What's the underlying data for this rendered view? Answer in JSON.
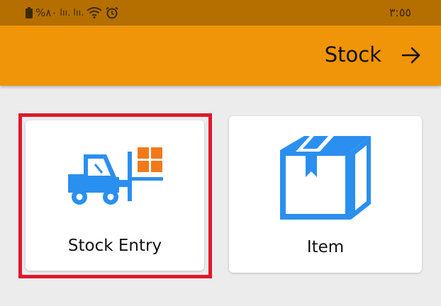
{
  "status_bar": {
    "battery": "%٨٠",
    "signal1": "lıı.",
    "signal2": "lıı.",
    "time": "٣:٥٥"
  },
  "header": {
    "title": "Stock",
    "back_icon": "arrow-right-icon"
  },
  "cards": [
    {
      "label": "Stock Entry",
      "icon": "forklift-icon",
      "selected": true
    },
    {
      "label": "Item",
      "icon": "box-icon",
      "selected": false
    }
  ],
  "colors": {
    "status_bar": "#b56f00",
    "app_bar": "#f09408",
    "icon_blue": "#2b8ff0",
    "icon_orange": "#f07a1a",
    "highlight": "#e0182b",
    "background": "#ececec"
  }
}
